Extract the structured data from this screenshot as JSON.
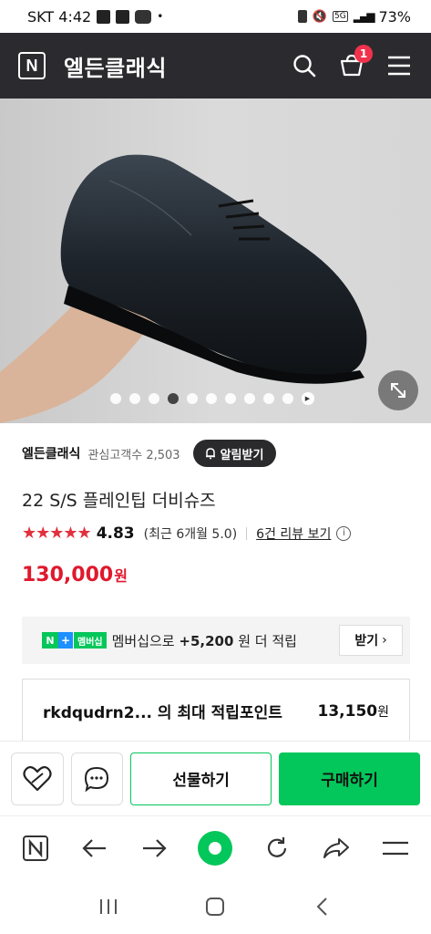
{
  "status_bar": {
    "carrier_time": "SKT 4:42",
    "battery": "73%",
    "network": "5G"
  },
  "header": {
    "logo": "N",
    "title": "엘든클래식",
    "cart_count": "1"
  },
  "gallery": {
    "dot_count": 10,
    "active_index": 3
  },
  "store": {
    "name": "엘든클래식",
    "followers": "관심고객수 2,503",
    "notify_label": "알림받기"
  },
  "product": {
    "title": "22 S/S 플레인팁 더비슈즈",
    "stars": "★★★★★",
    "rating": "4.83",
    "recent_rating": "(최근 6개월 5.0)",
    "review_link": "6건 리뷰 보기",
    "price": "130,000",
    "currency": "원"
  },
  "membership": {
    "badge_n": "N",
    "badge_plus": "+",
    "badge_label": "멤버십",
    "text_prefix": "멤버십으로",
    "text_amount": "+5,200",
    "text_suffix": "원 더 적립",
    "button": "받기"
  },
  "points": {
    "label": "rkdqudrn2... 의 최대 적립포인트",
    "value": "13,150",
    "unit": "원"
  },
  "actions": {
    "gift": "선물하기",
    "buy": "구매하기"
  },
  "colors": {
    "brand_green": "#03c75a",
    "price_red": "#e0182d",
    "header_dark": "#2b2b2f"
  }
}
